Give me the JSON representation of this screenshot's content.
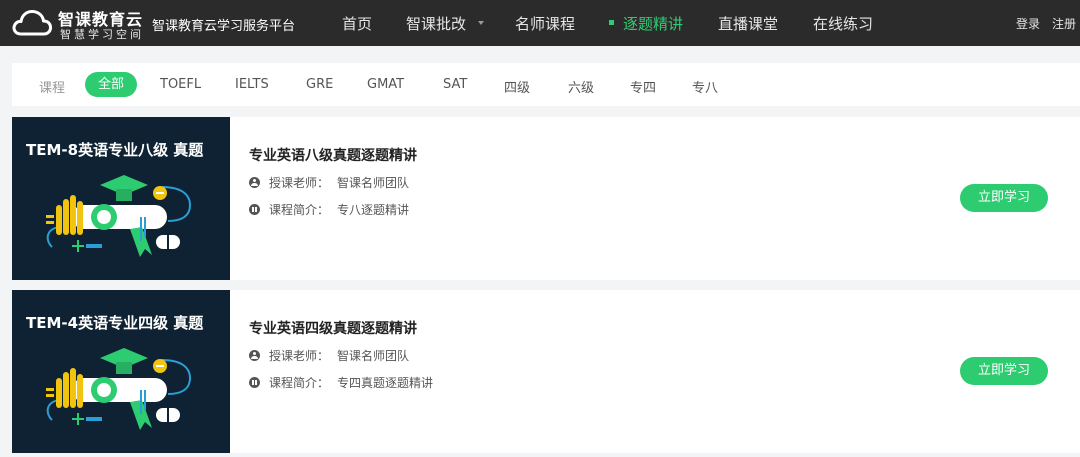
{
  "header": {
    "logo_title": "智课教育云",
    "logo_subtitle": "智慧学习空间",
    "platform_name": "智课教育云学习服务平台",
    "nav": [
      {
        "label": "首页"
      },
      {
        "label": "智课批改"
      },
      {
        "label": "名师课程"
      },
      {
        "label": "逐题精讲"
      },
      {
        "label": "直播课堂"
      },
      {
        "label": "在线练习"
      }
    ],
    "active_nav": "逐题精讲",
    "login": "登录",
    "register": "注册"
  },
  "filters": {
    "label": "课程",
    "items": [
      "全部",
      "TOEFL",
      "IELTS",
      "GRE",
      "GMAT",
      "SAT",
      "四级",
      "六级",
      "专四",
      "专八"
    ],
    "active": "全部"
  },
  "courses": [
    {
      "thumb_title": "TEM-8英语专业八级  真题",
      "title": "专业英语八级真题逐题精讲",
      "teacher_label": "授课老师：",
      "teacher": "智课名师团队",
      "intro_label": "课程简介：",
      "intro": "专八逐题精讲",
      "button": "立即学习"
    },
    {
      "thumb_title": "TEM-4英语专业四级  真题",
      "title": "专业英语四级真题逐题精讲",
      "teacher_label": "授课老师：",
      "teacher": "智课名师团队",
      "intro_label": "课程简介：",
      "intro": "专四真题逐题精讲",
      "button": "立即学习"
    }
  ],
  "colors": {
    "accent": "#2ecc71",
    "topbar": "#2b2b2b",
    "thumb_bg": "#0f2233"
  }
}
